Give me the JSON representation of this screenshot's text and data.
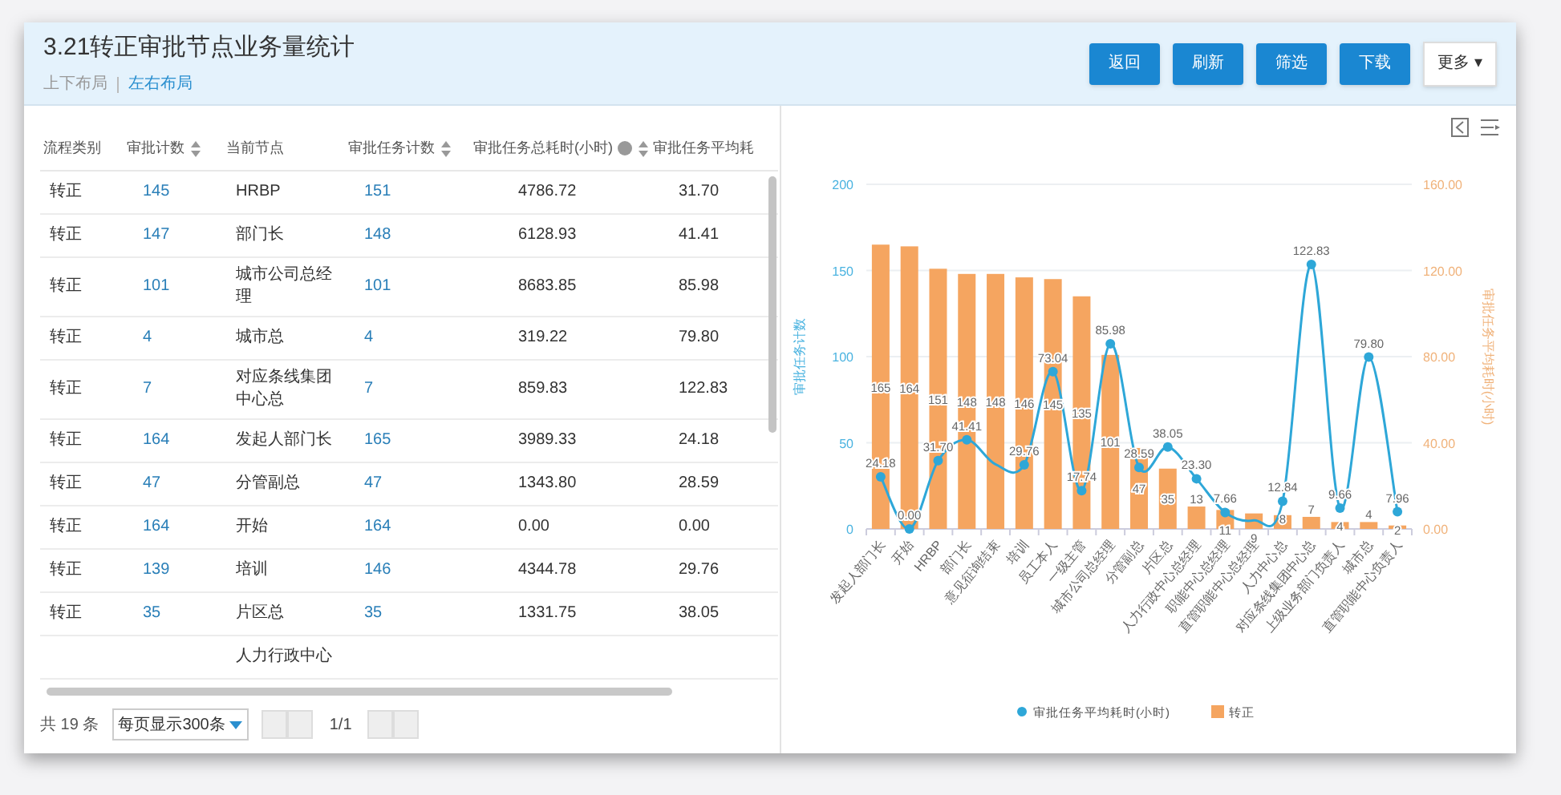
{
  "header": {
    "title": "3.21转正审批节点业务量统计",
    "layouts": [
      {
        "label": "上下布局",
        "selected": false
      },
      {
        "label": "左右布局",
        "selected": true
      }
    ],
    "buttons": [
      "返回",
      "刷新",
      "筛选",
      "下载"
    ],
    "more_menu": "更多 ▾"
  },
  "table": {
    "columns": [
      {
        "label": "流程类别",
        "sortable": false,
        "help": false
      },
      {
        "label": "审批计数",
        "sortable": true,
        "help": false
      },
      {
        "label": "当前节点",
        "sortable": false,
        "help": false
      },
      {
        "label": "审批任务计数",
        "sortable": true,
        "help": false
      },
      {
        "label": "审批任务总耗时(小时)",
        "sortable": true,
        "help": true
      },
      {
        "label": "审批任务平均耗",
        "sortable": false,
        "help": false
      }
    ],
    "rows": [
      {
        "cells": [
          "转正",
          "145",
          "HRBP",
          "151",
          "4786.72",
          "31.70"
        ]
      },
      {
        "cells": [
          "转正",
          "147",
          "部门长",
          "148",
          "6128.93",
          "41.41"
        ]
      },
      {
        "cells": [
          "转正",
          "101",
          "城市公司总经理",
          "101",
          "8683.85",
          "85.98"
        ]
      },
      {
        "cells": [
          "转正",
          "4",
          "城市总",
          "4",
          "319.22",
          "79.80"
        ]
      },
      {
        "cells": [
          "转正",
          "7",
          "对应条线集团中心总",
          "7",
          "859.83",
          "122.83"
        ]
      },
      {
        "cells": [
          "转正",
          "164",
          "发起人部门长",
          "165",
          "3989.33",
          "24.18"
        ]
      },
      {
        "cells": [
          "转正",
          "47",
          "分管副总",
          "47",
          "1343.80",
          "28.59"
        ]
      },
      {
        "cells": [
          "转正",
          "164",
          "开始",
          "164",
          "0.00",
          "0.00"
        ]
      },
      {
        "cells": [
          "转正",
          "139",
          "培训",
          "146",
          "4344.78",
          "29.76"
        ]
      },
      {
        "cells": [
          "转正",
          "35",
          "片区总",
          "35",
          "1331.75",
          "38.05"
        ]
      },
      {
        "cells": [
          "",
          "",
          "人力行政中心",
          "",
          "",
          ""
        ]
      }
    ]
  },
  "pager": {
    "total": "共 19 条",
    "page_size": "每页显示300条",
    "page": "1/1"
  },
  "chart_data": {
    "type": "bar",
    "ylabel": "审批任务计数",
    "y2label": "审批任务平均耗时(小时)",
    "categories": [
      "发起人部门长",
      "开始",
      "HRBP",
      "部门长",
      "意见征询结束",
      "培训",
      "员工本人",
      "一级主管",
      "城市公司总经理",
      "分管副总",
      "片区总",
      "人力行政中心总经理",
      "职能中心总经理",
      "直管职能中心总经理",
      "人力中心总",
      "对应条线集团中心总",
      "上级业务部门负责人",
      "城市总",
      "直管职能中心负责人"
    ],
    "series": [
      {
        "name": "审批任务平均耗时(小时)",
        "type": "line",
        "axis": "y2",
        "marker": true,
        "color": "#2ea7d8",
        "values": [
          24.18,
          0.0,
          31.7,
          41.41,
          30,
          29.76,
          73.04,
          17.74,
          85.98,
          28.59,
          38.05,
          23.3,
          7.66,
          4,
          12.84,
          122.83,
          9.66,
          79.8,
          7.96
        ],
        "value_labels": [
          "24.18",
          "0.00",
          "31.70",
          "41.41",
          null,
          "29.76",
          "73.04",
          "17.74",
          "85.98",
          "28.59",
          "38.05",
          "23.30",
          "7.66",
          null,
          "12.84",
          "122.83",
          "9.66",
          "79.80",
          "7.96"
        ]
      },
      {
        "name": "转正",
        "type": "bar",
        "color": "#f5a560",
        "values": [
          165,
          164,
          151,
          148,
          148,
          146,
          145,
          135,
          101,
          47,
          35,
          13,
          11,
          9,
          8,
          7,
          4,
          4,
          2
        ],
        "value_labels": [
          "165",
          "164",
          "151",
          "148",
          "148",
          "146",
          "145",
          "135",
          "101",
          "47",
          "35",
          "13",
          "11",
          "9",
          "8",
          "7",
          "4",
          "4",
          "2"
        ]
      }
    ],
    "grid": true,
    "legend": "bottom",
    "ylim": [
      0,
      200
    ],
    "yticks": [
      0,
      50,
      100,
      150,
      200
    ],
    "y2lim": [
      0,
      160
    ],
    "y2ticks": [
      {
        "value": 0,
        "label": "0.00"
      },
      {
        "value": 40,
        "label": "40.00"
      },
      {
        "value": 80,
        "label": "80.00"
      },
      {
        "value": 120,
        "label": "120.00"
      },
      {
        "value": 160,
        "label": "160.00"
      }
    ]
  }
}
